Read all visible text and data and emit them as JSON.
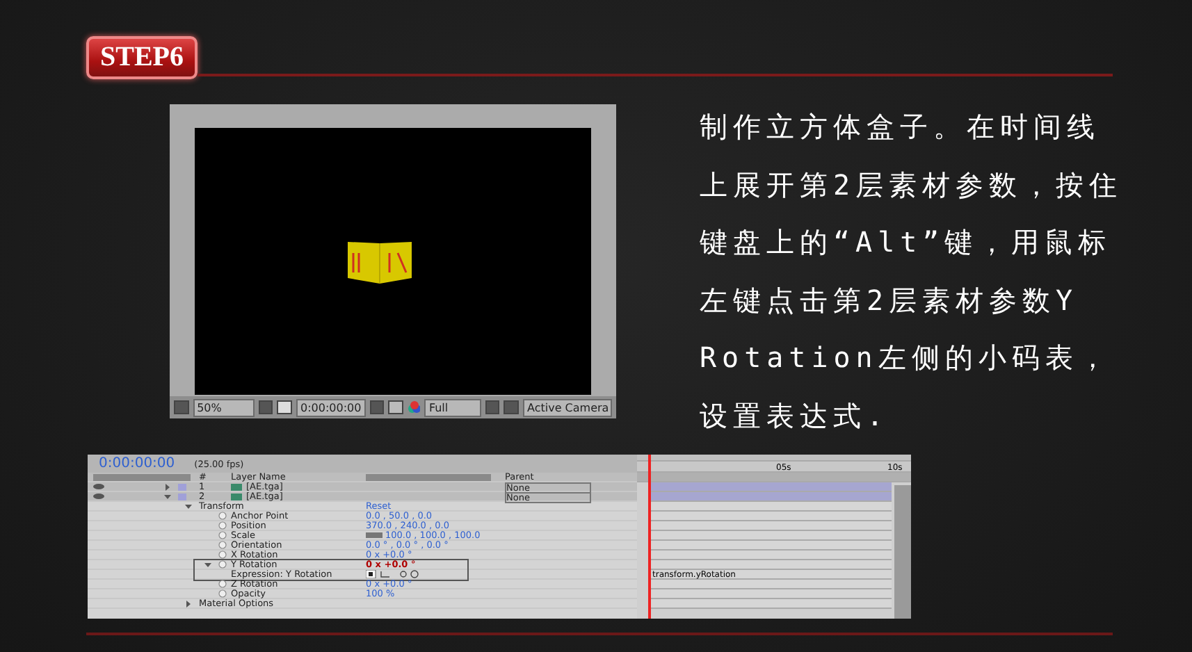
{
  "step_badge": "STEP6",
  "composition": {
    "zoom": "50%",
    "timecode": "0:00:00:00",
    "resolution": "Full",
    "camera": "Active Camera"
  },
  "description": "制作立方体盒子。在时间线上展开第2层素材参数，按住键盘上的“Alt”键，用鼠标左键点击第2层素材参数Y Rotation左侧的小码表，设置表达式.",
  "timeline": {
    "timecode": "0:00:00:00",
    "fps": "(25.00 fps)",
    "columns": {
      "number": "#",
      "layer_name": "Layer Name",
      "parent": "Parent"
    },
    "ruler_labels": [
      "05s",
      "10s"
    ],
    "layers": [
      {
        "number": "1",
        "name": "[AE.tga]",
        "parent": "None",
        "expanded": false
      },
      {
        "number": "2",
        "name": "[AE.tga]",
        "parent": "None",
        "expanded": true
      }
    ],
    "properties": [
      {
        "kind": "group",
        "label": "Transform",
        "value": "Reset",
        "expanded": true,
        "children": [
          {
            "kind": "property",
            "label": "Anchor Point",
            "value": "0.0 , 50.0 , 0.0"
          },
          {
            "kind": "property",
            "label": "Position",
            "value": "370.0 , 240.0 , 0.0"
          },
          {
            "kind": "scale",
            "label": "Scale",
            "value": "100.0 , 100.0 , 100.0"
          },
          {
            "kind": "property",
            "label": "Orientation",
            "value": "0.0 ° , 0.0 ° , 0.0 °"
          },
          {
            "kind": "property",
            "label": "X Rotation",
            "value": "0 x +0.0 °"
          },
          {
            "kind": "expression",
            "label": "Y Rotation",
            "value": "0 x +0.0 °",
            "expanded": true,
            "children": [
              {
                "kind": "expression_line",
                "label": "Expression: Y Rotation",
                "code": "transform.yRotation"
              }
            ]
          },
          {
            "kind": "property",
            "label": "Z Rotation",
            "value": "0 x +0.0 °"
          },
          {
            "kind": "property",
            "label": "Opacity",
            "value": "100 %"
          }
        ]
      },
      {
        "kind": "group",
        "label": "Material Options",
        "expanded": false
      }
    ]
  }
}
